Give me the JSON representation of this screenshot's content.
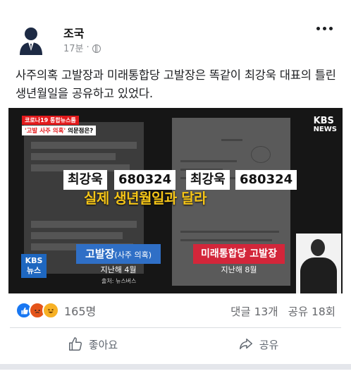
{
  "post": {
    "author": "조국",
    "time": "17분",
    "separator": "·",
    "text": "사주의혹 고발장과 미래통합당 고발장은 똑같이 최강욱 대표의 틀린 생년월일을 공유하고 있었다."
  },
  "video": {
    "news_tag": "코로나19 통합뉴스룸",
    "news_subtitle_a": "'고발 사주 의혹'",
    "news_subtitle_b": " 의문점은?",
    "brand_top": "KBS",
    "brand_bottom": "NEWS",
    "left_name": "최강욱",
    "left_number": "680324",
    "right_name": "최강욱",
    "right_number": "680324",
    "headline": "실제 생년월일과 달라",
    "left_caption": "고발장",
    "left_caption_paren": "(사주 의혹)",
    "left_caption_sub": "지난해 4월",
    "right_caption": "미래통합당 고발장",
    "right_caption_sub": "지난해 8월",
    "source": "출처: 뉴스버스",
    "bug_top": "KBS",
    "bug_bottom": "뉴스"
  },
  "engagement": {
    "reaction_count": "165명",
    "comments": "댓글 13개",
    "shares": "공유 18회"
  },
  "actions": {
    "like": "좋아요",
    "share": "공유"
  }
}
